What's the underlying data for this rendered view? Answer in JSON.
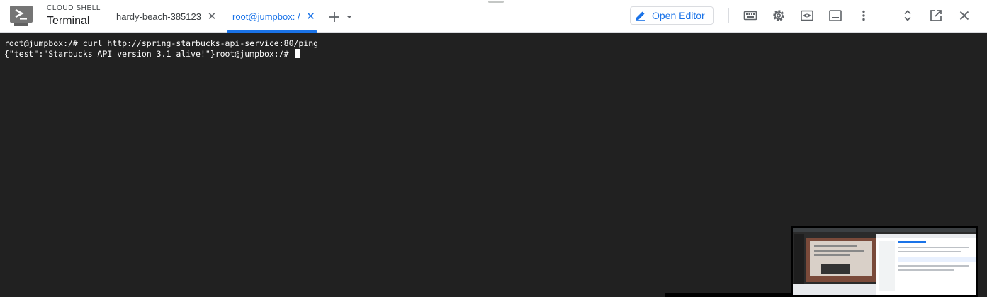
{
  "header": {
    "product_label": "CLOUD SHELL",
    "product_title": "Terminal"
  },
  "tabs": [
    {
      "label": "hardy-beach-385123",
      "active": false
    },
    {
      "label": "root@jumpbox: /",
      "active": true
    }
  ],
  "toolbar": {
    "open_editor_label": "Open Editor",
    "icons": [
      "keyboard-icon",
      "settings-icon",
      "web-preview-icon",
      "minimize-panel-icon",
      "more-vert-icon",
      "expand-collapse-icon",
      "open-in-new-window-icon",
      "close-icon"
    ]
  },
  "terminal": {
    "lines": [
      "root@jumpbox:/# curl http://spring-starbucks-api-service:80/ping",
      "{\"test\":\"Starbucks API version 3.1 alive!\"}root@jumpbox:/# "
    ]
  },
  "colors": {
    "accent": "#1a73e8",
    "terminal_bg": "#212121",
    "terminal_fg": "#ffffff",
    "icon": "#5f6368"
  }
}
